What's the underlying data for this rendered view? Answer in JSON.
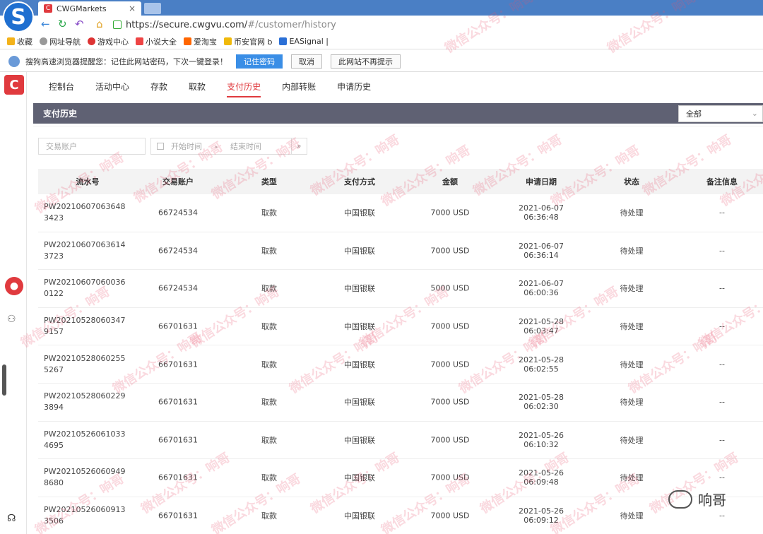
{
  "browser": {
    "tab_title": "CWGMarkets",
    "url_host": "https://secure.cwgvu.com/",
    "url_path": "#/customer/history",
    "bookmarks": [
      "收藏",
      "网址导航",
      "游戏中心",
      "小说大全",
      "爱淘宝",
      "币安官网 b",
      "EASignal |"
    ],
    "password_prompt": "搜狗高速浏览器提醒您：记住此网站密码，下次一键登录！",
    "password_buttons": [
      "记住密码",
      "取消",
      "此网站不再提示"
    ]
  },
  "nav": {
    "tabs": [
      "控制台",
      "活动中心",
      "存款",
      "取款",
      "支付历史",
      "内部转账",
      "申请历史"
    ],
    "active_index": 4
  },
  "panel": {
    "title": "支付历史",
    "status_filter": "全部",
    "account_placeholder": "交易账户",
    "start_placeholder": "开始时间",
    "range_separator": "-",
    "end_placeholder": "结束时间"
  },
  "table": {
    "headers": [
      "流水号",
      "交易账户",
      "类型",
      "支付方式",
      "金额",
      "申请日期",
      "状态",
      "备注信息"
    ],
    "rows": [
      [
        "PW202106070636483423",
        "66724534",
        "取款",
        "中国银联",
        "7000 USD",
        "2021-06-07 06:36:48",
        "待处理",
        "--"
      ],
      [
        "PW202106070636143723",
        "66724534",
        "取款",
        "中国银联",
        "7000 USD",
        "2021-06-07 06:36:14",
        "待处理",
        "--"
      ],
      [
        "PW202106070600360122",
        "66724534",
        "取款",
        "中国银联",
        "5000 USD",
        "2021-06-07 06:00:36",
        "待处理",
        "--"
      ],
      [
        "PW202105280603479157",
        "66701631",
        "取款",
        "中国银联",
        "7000 USD",
        "2021-05-28 06:03:47",
        "待处理",
        "--"
      ],
      [
        "PW202105280602555267",
        "66701631",
        "取款",
        "中国银联",
        "7000 USD",
        "2021-05-28 06:02:55",
        "待处理",
        "--"
      ],
      [
        "PW202105280602293894",
        "66701631",
        "取款",
        "中国银联",
        "7000 USD",
        "2021-05-28 06:02:30",
        "待处理",
        "--"
      ],
      [
        "PW202105260610334695",
        "66701631",
        "取款",
        "中国银联",
        "7000 USD",
        "2021-05-26 06:10:32",
        "待处理",
        "--"
      ],
      [
        "PW202105260609498680",
        "66701631",
        "取款",
        "中国银联",
        "7000 USD",
        "2021-05-26 06:09:48",
        "待处理",
        "--"
      ],
      [
        "PW202105260609133506",
        "66701631",
        "取款",
        "中国银联",
        "7000 USD",
        "2021-05-26 06:09:12",
        "待处理",
        "--"
      ]
    ]
  },
  "watermark": "微信公众号：响哥",
  "brand": "响哥"
}
